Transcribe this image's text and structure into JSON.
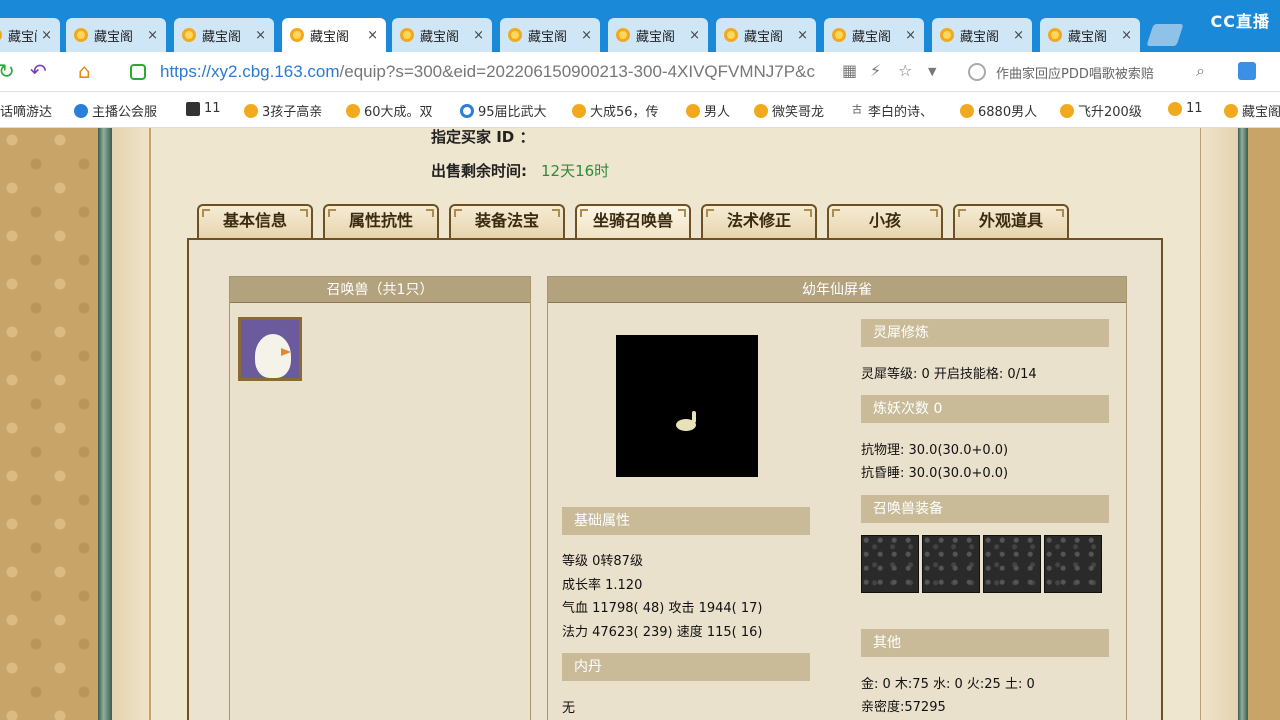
{
  "browser": {
    "brand": "CC直播",
    "tabs": [
      {
        "label": "藏宝阁"
      },
      {
        "label": "藏宝阁"
      },
      {
        "label": "藏宝阁"
      },
      {
        "label": "藏宝阁"
      },
      {
        "label": "藏宝阁"
      },
      {
        "label": "藏宝阁"
      },
      {
        "label": "藏宝阁"
      },
      {
        "label": "藏宝阁"
      },
      {
        "label": "藏宝阁"
      },
      {
        "label": "藏宝阁"
      },
      {
        "label": "藏宝阁"
      }
    ],
    "close_glyph": "×",
    "url_host": "https://xy2.cbg.163.com",
    "url_path": "/equip?s=300&eid=202206150900213-300-4XIVQFVMNJ7P&c",
    "search_placeholder": "作曲家回应PDD唱歌被索赔",
    "bookmarks": [
      {
        "label": "话嘀游达"
      },
      {
        "label": "主播公会服"
      },
      {
        "label": "11"
      },
      {
        "label": "3孩子高亲"
      },
      {
        "label": "60大成。双"
      },
      {
        "label": "95届比武大"
      },
      {
        "label": "大成56，传"
      },
      {
        "label": "男人"
      },
      {
        "label": "微笑哥龙"
      },
      {
        "label": "李白的诗、"
      },
      {
        "label": "6880男人"
      },
      {
        "label": "飞升200级"
      },
      {
        "label": "11"
      },
      {
        "label": "藏宝阁"
      }
    ]
  },
  "page": {
    "buyer_label": "指定买家 ID ：",
    "remaining_label": "出售剩余时间:",
    "remaining_value": "12天16时",
    "tabs": [
      "基本信息",
      "属性抗性",
      "装备法宝",
      "坐骑召唤兽",
      "法术修正",
      "小孩",
      "外观道具"
    ],
    "pet_list_title": "召唤兽（共1只）",
    "pet_title": "幼年仙屏雀",
    "basic": {
      "head": "基础属性",
      "level": "等级 0转87级",
      "growth": "成长率 1.120",
      "hp_atk": "气血 11798( 48) 攻击 1944( 17)",
      "mp_spd": "法力 47623( 239) 速度 115( 16)"
    },
    "neidan": {
      "head": "内丹",
      "value": "无"
    },
    "lingxi": {
      "head": "灵犀修炼",
      "line": "灵犀等级: 0    开启技能格: 0/14"
    },
    "lianyao": {
      "head": "炼妖次数 0",
      "phys": "抗物理: 30.0(30.0+0.0)",
      "sleep": "抗昏睡: 30.0(30.0+0.0)"
    },
    "equip_head": "召唤兽装备",
    "other": {
      "head": "其他",
      "elements": "金: 0 木:75 水: 0 火:25 土: 0",
      "intimacy": "亲密度:57295"
    }
  }
}
